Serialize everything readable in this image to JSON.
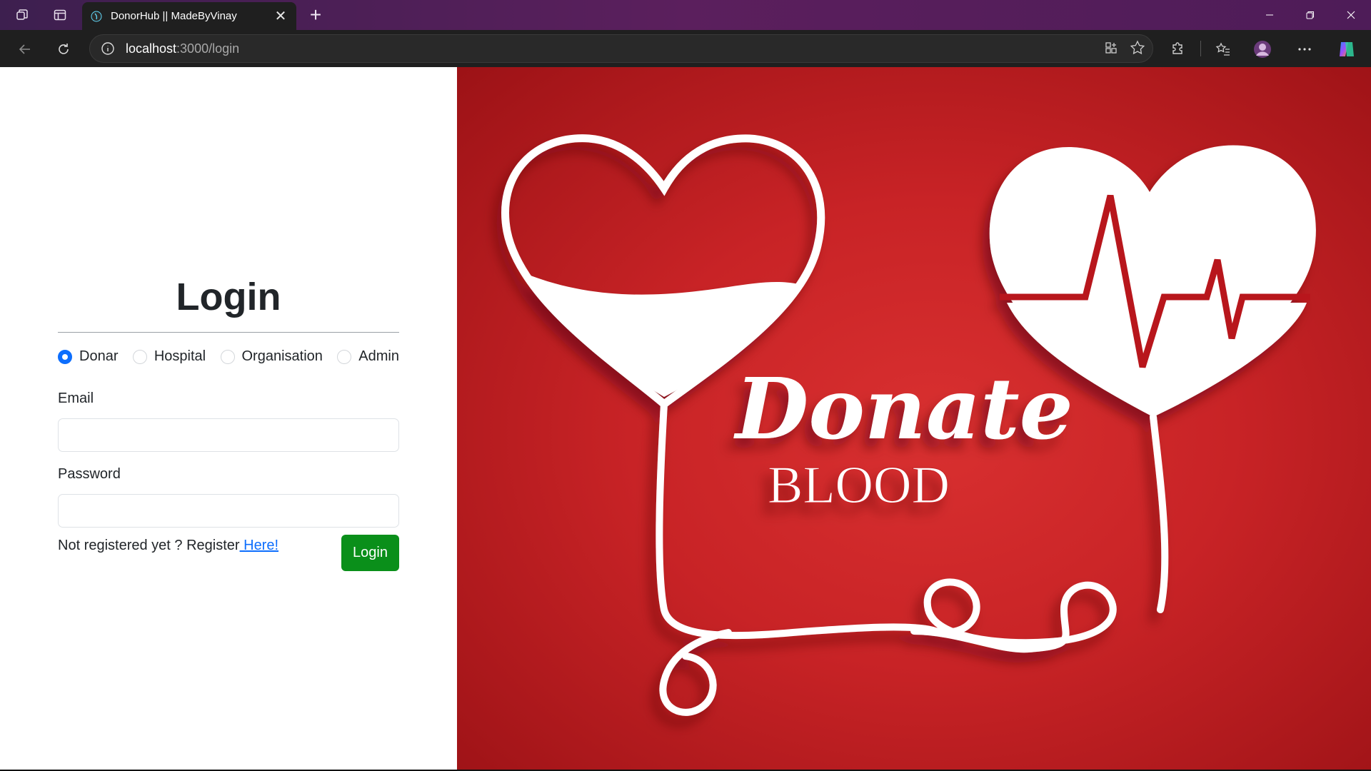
{
  "browser": {
    "tab_title": "DonorHub || MadeByVinay",
    "url_host": "localhost",
    "url_path": ":3000/login"
  },
  "login": {
    "title": "Login",
    "roles": [
      "Donar",
      "Hospital",
      "Organisation",
      "Admin"
    ],
    "selected_role": "Donar",
    "email_label": "Email",
    "email_value": "",
    "password_label": "Password",
    "password_value": "",
    "register_prefix": "Not registered yet ? Register",
    "register_link": " Here!",
    "login_button": "Login"
  },
  "banner": {
    "script_text": "Donate",
    "caps_text": "BLOOD"
  },
  "colors": {
    "accent": "#0d6efd",
    "login_button": "#0a8f1a",
    "banner_red": "#c82326",
    "tab_bar": "#4e1c58"
  },
  "icons": [
    "workspaces-icon",
    "tab-actions-icon",
    "favicon-icon",
    "close-tab-icon",
    "new-tab-icon",
    "minimize-icon",
    "restore-icon",
    "close-window-icon",
    "back-icon",
    "refresh-icon",
    "site-info-icon",
    "app-available-icon",
    "favorite-star-icon",
    "extensions-icon",
    "favorites-icon",
    "profile-icon",
    "more-icon",
    "copilot-icon"
  ]
}
